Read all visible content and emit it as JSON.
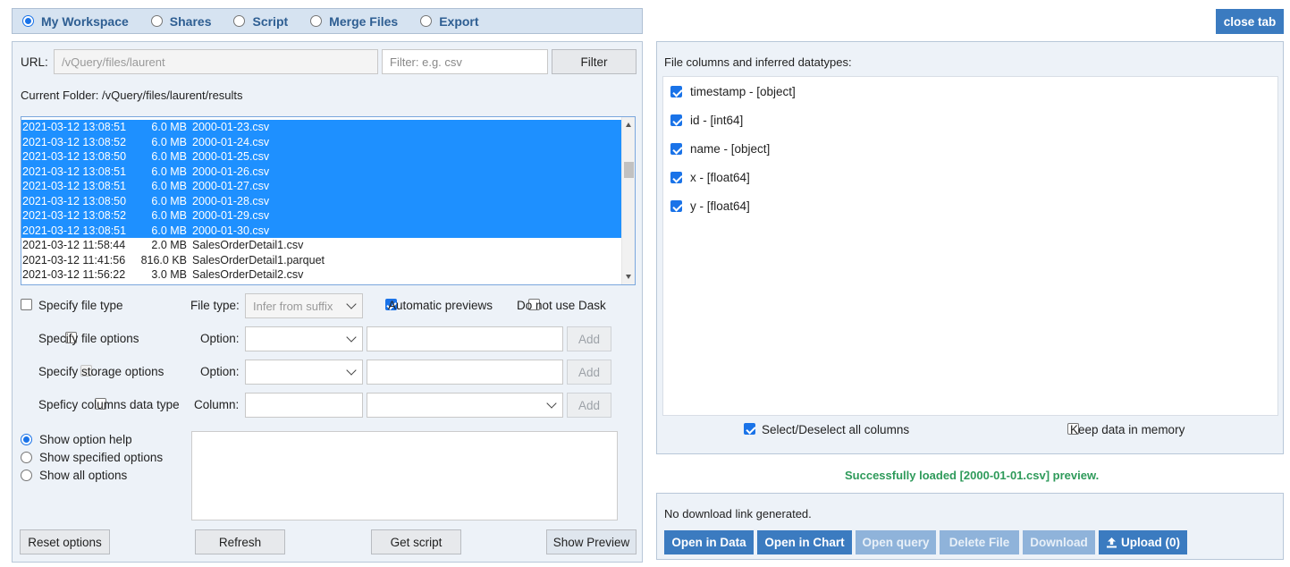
{
  "tabs": [
    {
      "label": "My Workspace",
      "selected": true
    },
    {
      "label": "Shares",
      "selected": false
    },
    {
      "label": "Script",
      "selected": false
    },
    {
      "label": "Merge Files",
      "selected": false
    },
    {
      "label": "Export",
      "selected": false
    }
  ],
  "close_tab_label": "close tab",
  "url": {
    "label": "URL:",
    "value": "/vQuery/files/laurent"
  },
  "filter": {
    "placeholder": "Filter: e.g. csv",
    "button": "Filter"
  },
  "current_folder": "Current Folder: /vQuery/files/laurent/results",
  "files": [
    {
      "date": "2021-03-12 13:08:51",
      "size": "6.0 MB",
      "name": "2000-01-23.csv",
      "selected": true
    },
    {
      "date": "2021-03-12 13:08:52",
      "size": "6.0 MB",
      "name": "2000-01-24.csv",
      "selected": true
    },
    {
      "date": "2021-03-12 13:08:50",
      "size": "6.0 MB",
      "name": "2000-01-25.csv",
      "selected": true
    },
    {
      "date": "2021-03-12 13:08:51",
      "size": "6.0 MB",
      "name": "2000-01-26.csv",
      "selected": true
    },
    {
      "date": "2021-03-12 13:08:51",
      "size": "6.0 MB",
      "name": "2000-01-27.csv",
      "selected": true
    },
    {
      "date": "2021-03-12 13:08:50",
      "size": "6.0 MB",
      "name": "2000-01-28.csv",
      "selected": true
    },
    {
      "date": "2021-03-12 13:08:52",
      "size": "6.0 MB",
      "name": "2000-01-29.csv",
      "selected": true
    },
    {
      "date": "2021-03-12 13:08:51",
      "size": "6.0 MB",
      "name": "2000-01-30.csv",
      "selected": true
    },
    {
      "date": "2021-03-12 11:58:44",
      "size": "2.0 MB",
      "name": "SalesOrderDetail1.csv",
      "selected": false
    },
    {
      "date": "2021-03-12 11:41:56",
      "size": "816.0 KB",
      "name": "SalesOrderDetail1.parquet",
      "selected": false
    },
    {
      "date": "2021-03-12 11:56:22",
      "size": "3.0 MB",
      "name": "SalesOrderDetail2.csv",
      "selected": false
    }
  ],
  "options": {
    "specify_file_type": "Specify file type",
    "file_type_label": "File type:",
    "file_type_value": "Infer from suffix",
    "automatic_previews": "Automatic previews",
    "do_not_use_dask": "Do not use Dask",
    "specify_file_options": "Specify file options",
    "specify_storage_options": "Specify storage options",
    "specify_columns_dtype": "Speficy columns data type",
    "option_label": "Option:",
    "column_label": "Column:",
    "add_label": "Add"
  },
  "help_modes": [
    {
      "label": "Show option help",
      "selected": true
    },
    {
      "label": "Show specified options",
      "selected": false
    },
    {
      "label": "Show all options",
      "selected": false
    }
  ],
  "buttons": {
    "reset": "Reset options",
    "refresh": "Refresh",
    "get_script": "Get script",
    "show_preview": "Show Preview"
  },
  "columns_title": "File columns and inferred datatypes:",
  "columns": [
    "timestamp - [object]",
    "id - [int64]",
    "name - [object]",
    "x - [float64]",
    "y - [float64]"
  ],
  "select_all": "Select/Deselect all columns",
  "keep_in_memory": "Keep data in memory",
  "status_message": "Successfully loaded [2000-01-01.csv] preview.",
  "download_status": "No download link generated.",
  "actions": {
    "open_data": "Open in Data",
    "open_chart": "Open in Chart",
    "open_query": "Open query",
    "delete_file": "Delete File",
    "download": "Download",
    "upload": "Upload (0)"
  },
  "colors": {
    "accent": "#3b7bc0",
    "selection": "#1e90ff",
    "success": "#2e9a5a"
  }
}
